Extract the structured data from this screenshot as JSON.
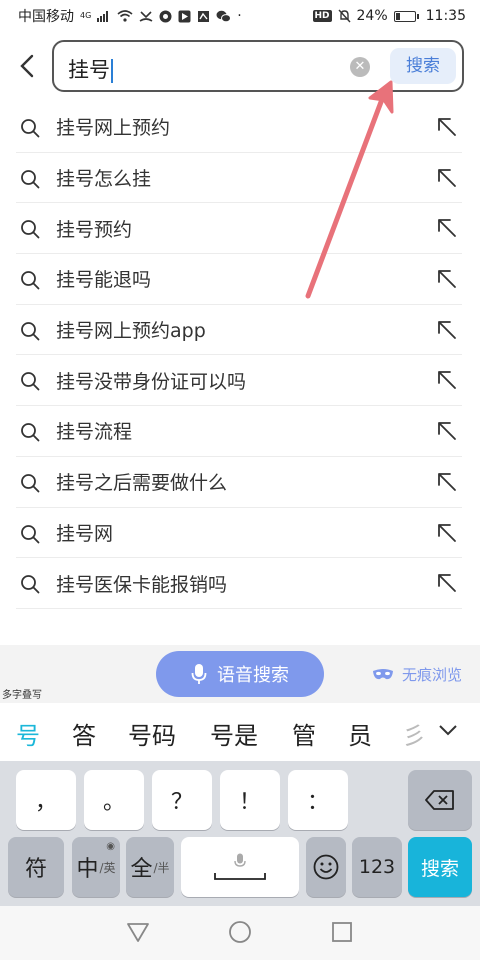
{
  "status_bar": {
    "carrier": "中国移动",
    "network": "4G",
    "hd": "HD",
    "battery": "24%",
    "battery_level": 0.24,
    "time": "11:35"
  },
  "search": {
    "query": "挂号",
    "submit_label": "搜索"
  },
  "suggestions": [
    "挂号网上预约",
    "挂号怎么挂",
    "挂号预约",
    "挂号能退吗",
    "挂号网上预约app",
    "挂号没带身份证可以吗",
    "挂号流程",
    "挂号之后需要做什么",
    "挂号网",
    "挂号医保卡能报销吗"
  ],
  "voice_search": {
    "label": "语音搜索",
    "incognito_label": "无痕浏览"
  },
  "keyboard": {
    "multichar_label": "多字叠写",
    "candidates": [
      "号",
      "答",
      "号码",
      "号是",
      "管",
      "员"
    ],
    "candidate_fade": "彡",
    "row1": [
      "，",
      "。",
      "？",
      "！",
      "："
    ],
    "row2": {
      "symbol": "符",
      "lang_main": "中",
      "lang_sub": "/英",
      "width_main": "全",
      "width_sub": "/半",
      "num": "123",
      "search": "搜索"
    },
    "accent_color": "#18b4da"
  },
  "colors": {
    "voice_button": "#7f99ec",
    "annotation_arrow": "#e8727a"
  }
}
